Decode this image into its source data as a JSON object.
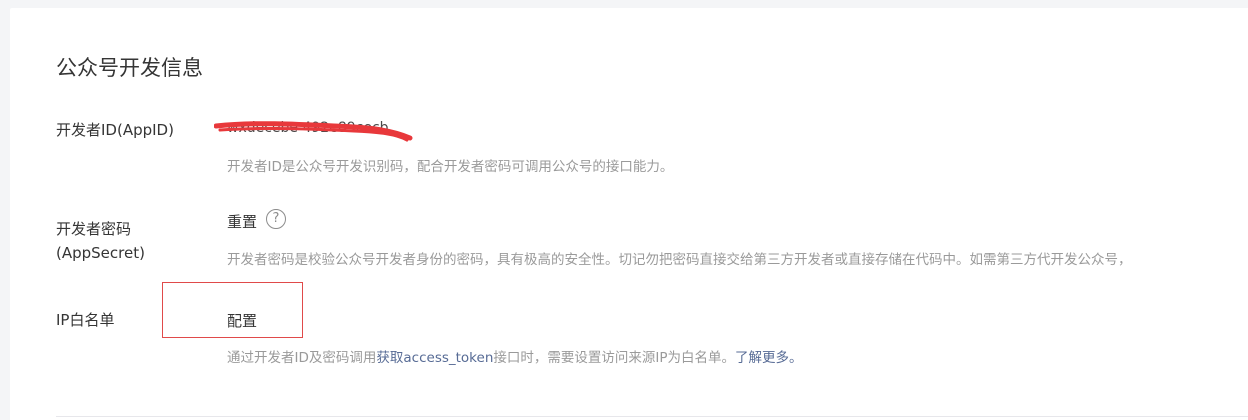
{
  "section": {
    "title": "公众号开发信息"
  },
  "app_id": {
    "label": "开发者ID(AppID)",
    "value": "wxdecebe 492e89cecb",
    "description": "开发者ID是公众号开发识别码，配合开发者密码可调用公众号的接口能力。"
  },
  "app_secret": {
    "label_line1": "开发者密码",
    "label_line2": "(AppSecret)",
    "action": "重置",
    "help_glyph": "?",
    "description": "开发者密码是校验公众号开发者身份的密码，具有极高的安全性。切记勿把密码直接交给第三方开发者或直接存储在代码中。如需第三方代开发公众号，"
  },
  "ip_whitelist": {
    "label": "IP白名单",
    "action": "配置",
    "description_prefix": "通过开发者ID及密码调用",
    "description_link": "获取access_token",
    "description_middle": "接口时，需要设置访问来源IP为白名单。",
    "learn_more": "了解更多。"
  },
  "icons": {
    "help": "question-circle-icon"
  },
  "colors": {
    "link_blue": "#576b95",
    "annotation_red": "#e04a4a",
    "redaction_red": "#e8383b"
  }
}
